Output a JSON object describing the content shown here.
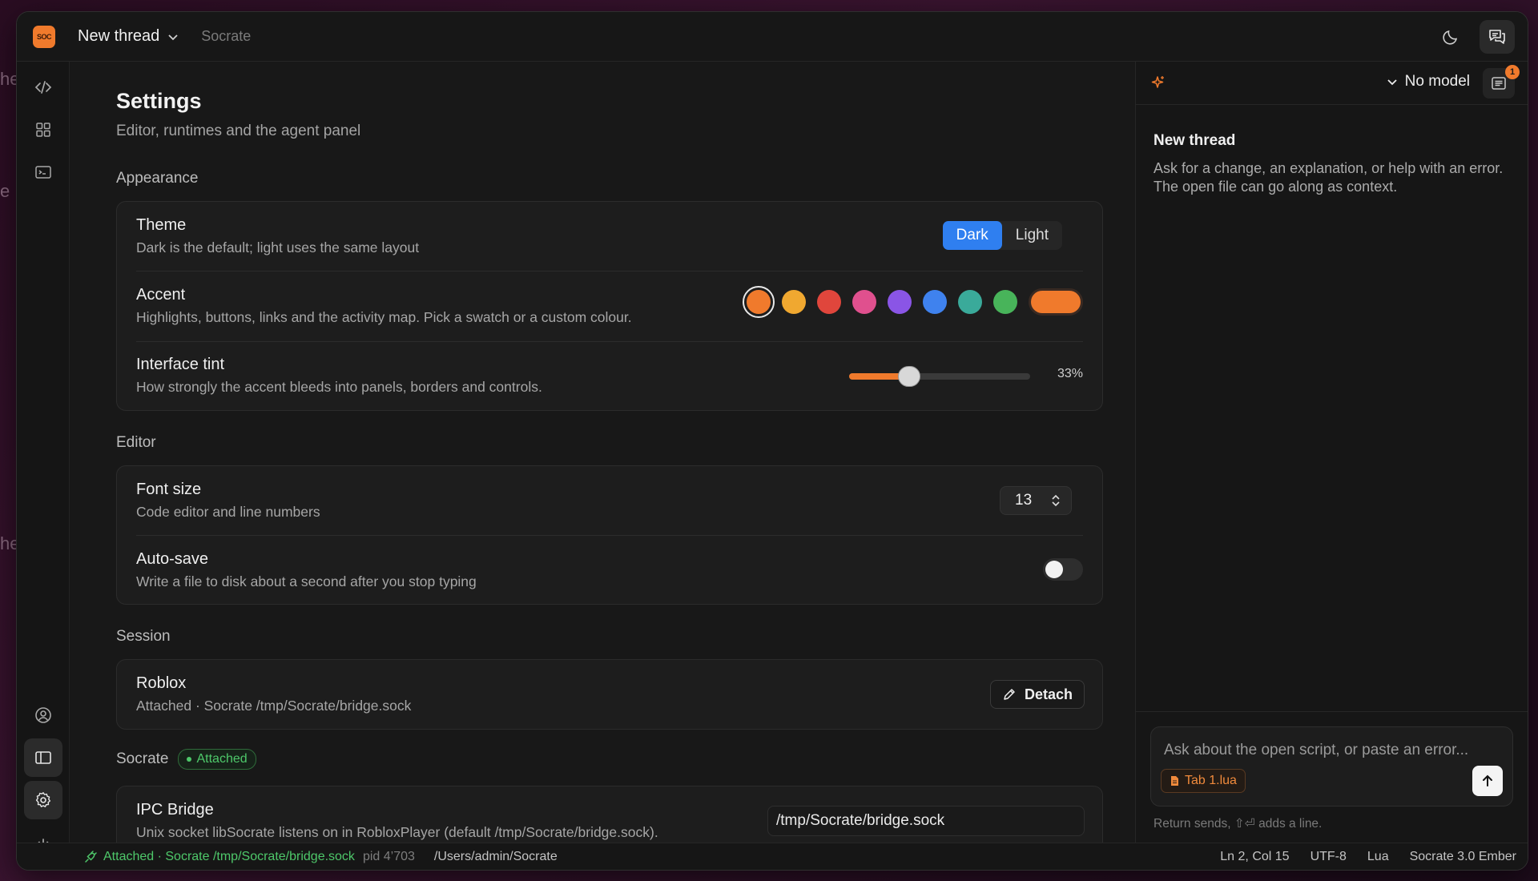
{
  "titlebar": {
    "thread_title": "New thread",
    "app_name": "Socrate",
    "logo_text": "SOC"
  },
  "settings": {
    "title": "Settings",
    "subtitle": "Editor, runtimes and the agent panel",
    "appearance": {
      "label": "Appearance",
      "theme": {
        "title": "Theme",
        "desc": "Dark is the default; light uses the same layout",
        "options": [
          "Dark",
          "Light"
        ],
        "selected": "Dark"
      },
      "accent": {
        "title": "Accent",
        "desc": "Highlights, buttons, links and the activity map. Pick a swatch or a custom colour.",
        "swatches": [
          "#f07a2c",
          "#f0a830",
          "#e0463c",
          "#e0508e",
          "#8a55e6",
          "#3f82ee",
          "#3aaa9a",
          "#48b45a"
        ],
        "selected_index": 0,
        "custom_color": "#f07a2c"
      },
      "tint": {
        "title": "Interface tint",
        "desc": "How strongly the accent bleeds into panels, borders and controls.",
        "value_percent": 33,
        "value_label": "33%"
      }
    },
    "editor": {
      "label": "Editor",
      "font_size": {
        "title": "Font size",
        "desc": "Code editor and line numbers",
        "value": "13"
      },
      "autosave": {
        "title": "Auto-save",
        "desc": "Write a file to disk about a second after you stop typing",
        "enabled": false
      }
    },
    "session": {
      "label": "Session",
      "roblox": {
        "title": "Roblox",
        "desc": "Attached · Socrate /tmp/Socrate/bridge.sock",
        "button": "Detach"
      }
    },
    "socrate": {
      "label": "Socrate",
      "badge": "Attached",
      "ipc": {
        "title": "IPC Bridge",
        "desc": "Unix socket libSocrate listens on in RobloxPlayer (default /tmp/Socrate/bridge.sock).",
        "value": "/tmp/Socrate/bridge.sock"
      }
    }
  },
  "agent": {
    "model": "No model",
    "notif_count": "1",
    "title": "New thread",
    "desc": "Ask for a change, an explanation, or help with an error. The open file can go along as context.",
    "composer_placeholder": "Ask about the open script, or paste an error...",
    "context_chip": "Tab 1.lua",
    "hint": "Return sends, ⇧⏎ adds a line."
  },
  "statusbar": {
    "attached": "Attached · Socrate /tmp/Socrate/bridge.sock",
    "pid": "pid 4’703",
    "cwd": "/Users/admin/Socrate",
    "position": "Ln 2, Col 15",
    "encoding": "UTF-8",
    "language": "Lua",
    "version": "Socrate 3.0 Ember"
  },
  "colors": {
    "accent": "#f07a2c",
    "selected_blue": "#2f7ff0",
    "success": "#4ec86a"
  }
}
